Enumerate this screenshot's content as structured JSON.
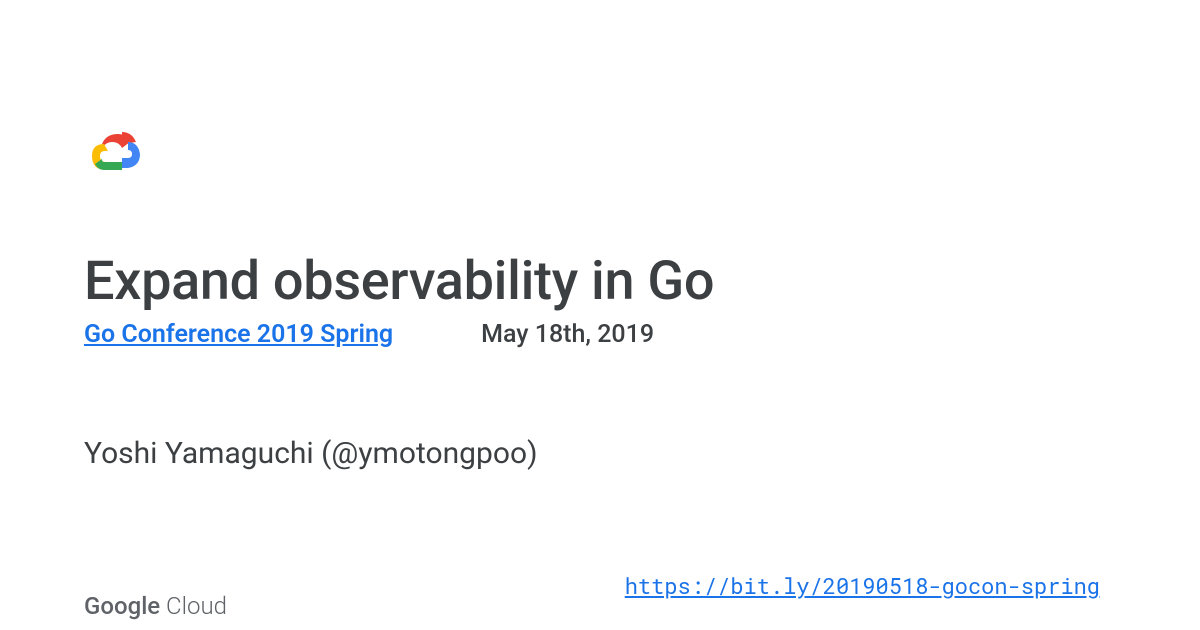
{
  "title": "Expand observability in Go",
  "conference": {
    "name": "Go Conference 2019 Spring",
    "date": "May 18th, 2019"
  },
  "speaker": "Yoshi Yamaguchi (@ymotongpoo)",
  "footer": {
    "brand_google": "Google",
    "brand_cloud": " Cloud"
  },
  "short_link": "https://bit.ly/20190518-gocon-spring"
}
